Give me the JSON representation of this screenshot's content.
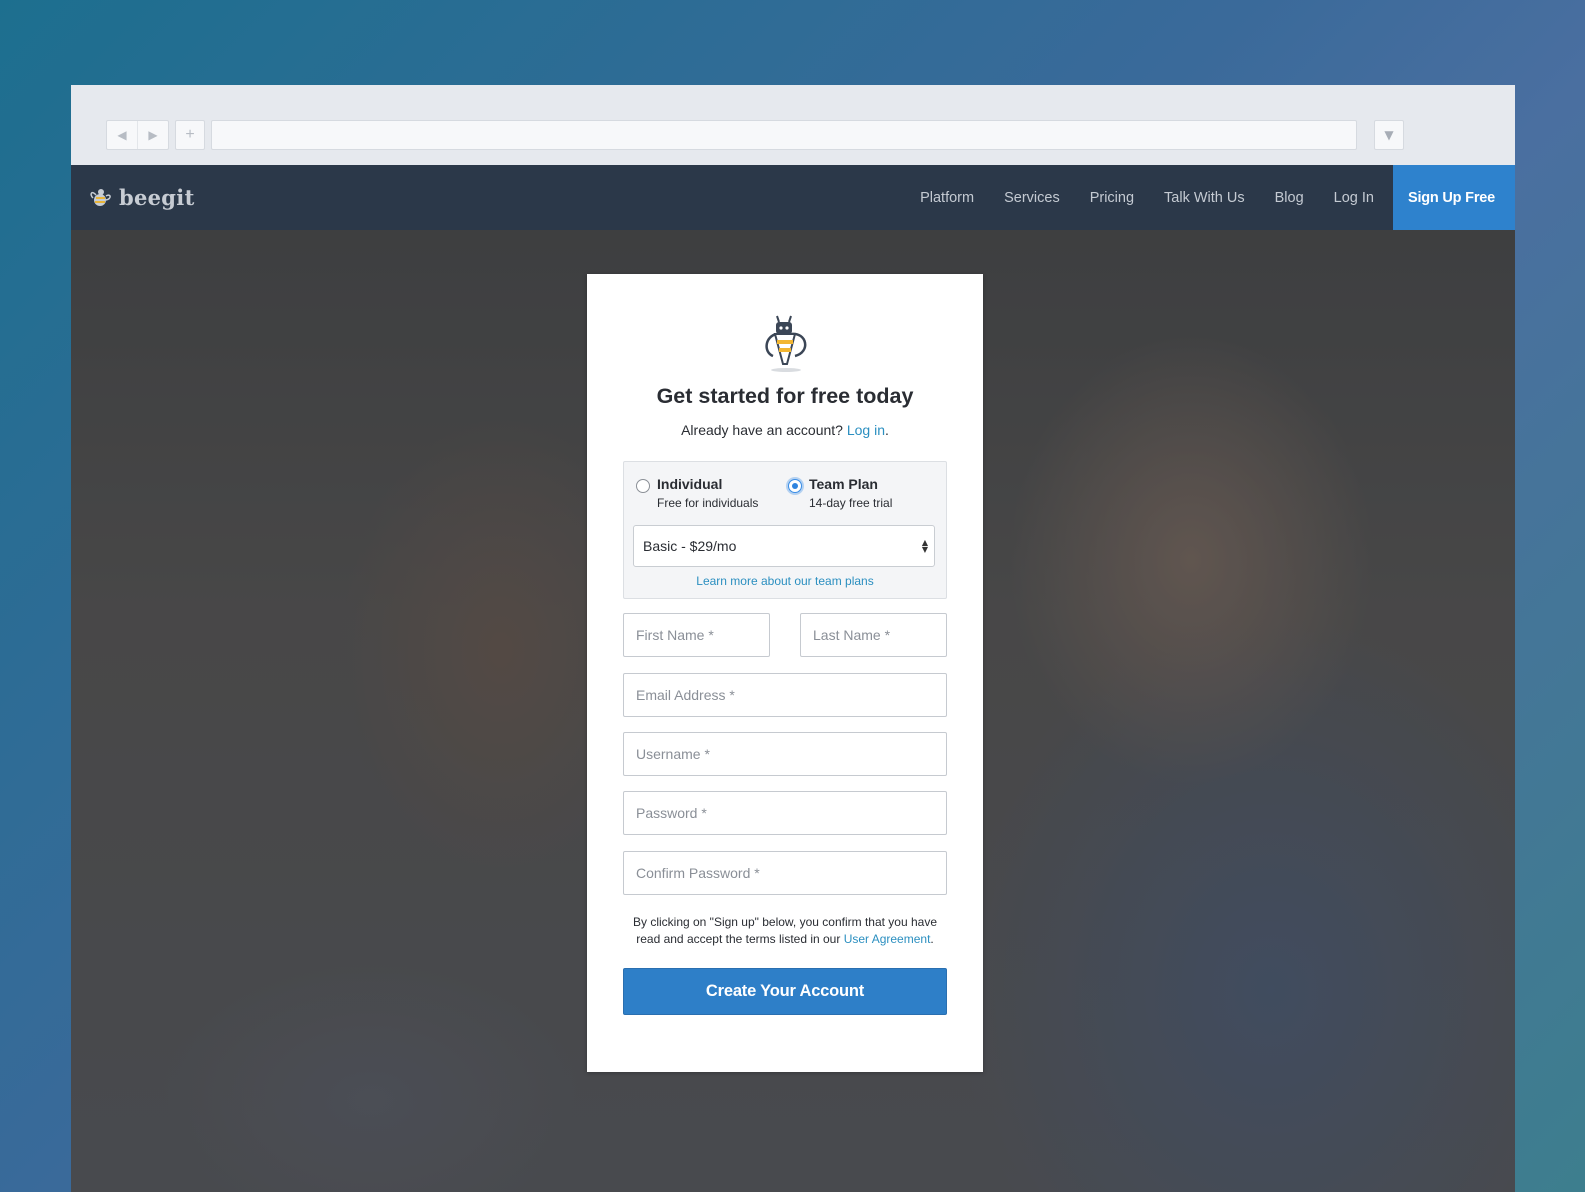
{
  "browser": {
    "back_glyph": "◀",
    "forward_glyph": "▶",
    "new_tab_glyph": "+",
    "menu_glyph": "▼"
  },
  "site": {
    "brand": "beegit",
    "nav": [
      "Platform",
      "Services",
      "Pricing",
      "Talk With Us",
      "Blog",
      "Log In"
    ],
    "cta": "Sign Up Free",
    "cta_color": "#2e82cd",
    "nav_bg_color": "#2b3849"
  },
  "signup": {
    "title": "Get started for free today",
    "already_text": "Already have an account?",
    "login_link": "Log in",
    "login_period": ".",
    "plans": [
      {
        "name": "Individual",
        "desc": "Free for individuals",
        "selected": false
      },
      {
        "name": "Team Plan",
        "desc": "14-day free trial",
        "selected": true
      }
    ],
    "plan_select_value": "Basic - $29/mo",
    "plan_link": "Learn more about our team plans",
    "fields": {
      "first_name": "First Name *",
      "last_name": "Last Name *",
      "email": "Email Address *",
      "username": "Username *",
      "password": "Password *",
      "confirm_password": "Confirm Password *"
    },
    "legal_text": "By clicking on \"Sign up\" below, you confirm that you have read and accept the terms listed in our",
    "legal_link": "User Agreement",
    "legal_period": ".",
    "submit": "Create Your Account",
    "submit_color": "#2e7fc8",
    "link_color": "#2b8fc0"
  }
}
